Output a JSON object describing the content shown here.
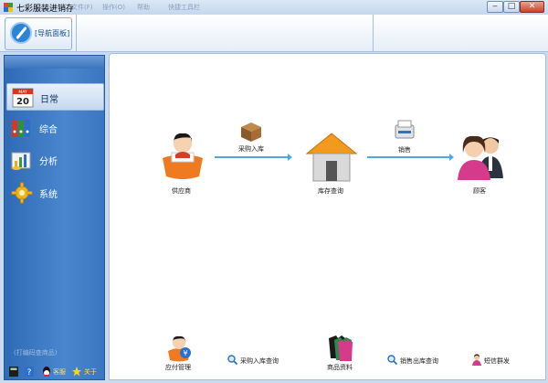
{
  "window": {
    "title": "七彩服装进销存",
    "menu_faded": [
      "文件(F)",
      "操作(O)",
      "帮助",
      "快捷工具栏"
    ],
    "controls": {
      "minimize": "‒",
      "restore": "□",
      "close": "✕"
    }
  },
  "toolbar": {
    "nav_panel_label": "[导航面板]"
  },
  "sidebar": {
    "items": [
      {
        "label": "日常",
        "icon": "calendar-icon",
        "active": true,
        "calendar_month": "MAY",
        "calendar_day": "20"
      },
      {
        "label": "综合",
        "icon": "binders-icon",
        "active": false
      },
      {
        "label": "分析",
        "icon": "chart-icon",
        "active": false
      },
      {
        "label": "系统",
        "icon": "gear-icon",
        "active": false
      }
    ],
    "hint": "(打编码查商品)",
    "bottom": [
      {
        "label": "",
        "icon": "calculator-icon"
      },
      {
        "label": "",
        "icon": "help-icon"
      },
      {
        "label": "客服",
        "icon": "qq-icon"
      },
      {
        "label": "关于",
        "icon": "star-icon"
      }
    ]
  },
  "flow": {
    "supplier": "供应商",
    "purchase_in": "采购入库",
    "inventory_query": "库存查询",
    "sales": "销售",
    "customer": "顾客"
  },
  "bottom_actions": {
    "payables": "应付管理",
    "purchase_query": "采购入库查询",
    "products": "商品资料",
    "sales_out_query": "销售出库查询",
    "sms": "短信群发"
  },
  "colors": {
    "sidebar": "#3b76c0",
    "arrow": "#4ea7e6",
    "accent": "#2c84d4"
  }
}
